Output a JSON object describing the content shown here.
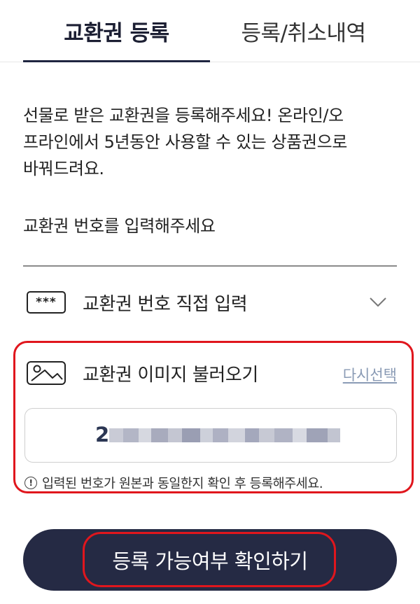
{
  "tabs": [
    {
      "label": "교환권 등록",
      "active": true
    },
    {
      "label": "등록/취소내역",
      "active": false
    }
  ],
  "description": {
    "line1": "선물로 받은 교환권을 등록해주세요! 온라인/오",
    "line2": "프라인에서 5년동안 사용할 수 있는 상품권으로",
    "line3": "바꿔드려요."
  },
  "prompt": "교환권 번호를 입력해주세요",
  "options": {
    "direct": {
      "icon_text": "***",
      "label": "교환권 번호 직접 입력",
      "icon": "chevron-down-icon"
    },
    "image": {
      "icon": "image-icon",
      "label": "교환권 이미지 불러오기",
      "reselect_label": "다시선택"
    }
  },
  "code_input": {
    "first_digit": "2",
    "rest": "masked"
  },
  "notice": {
    "icon": "info-icon",
    "icon_text": "!",
    "text": "입력된 번호가 원본과 동일한지 확인 후 등록해주세요."
  },
  "submit_label": "등록 가능여부 확인하기",
  "colors": {
    "primary": "#252a44",
    "highlight": "#e0161d",
    "link": "#8a9bb5"
  }
}
